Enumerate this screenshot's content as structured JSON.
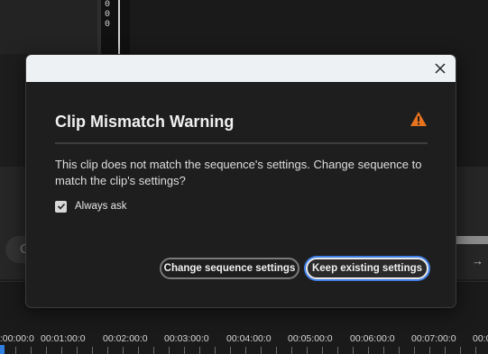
{
  "background": {
    "meter_values": [
      "0",
      "0",
      "0"
    ],
    "search_pill_text": "C",
    "timeline_labels": [
      "0:00:00:0",
      "00:01:00:0",
      "00:02:00:0",
      "00:03:00:0",
      "00:04:00:0",
      "00:05:00:0",
      "00:06:00:0",
      "00:07:00:0",
      "00:0"
    ]
  },
  "dialog": {
    "title": "Clip Mismatch Warning",
    "icon": "warning-icon",
    "message": "This clip does not match the sequence's settings. Change sequence to match the clip's settings?",
    "checkbox_label": "Always ask",
    "checkbox_checked": true,
    "secondary_button": "Change sequence settings",
    "primary_button": "Keep existing settings",
    "close_icon": "close-icon"
  },
  "colors": {
    "warning": "#e8731f",
    "focus_ring": "#3f7fe6",
    "playhead": "#2f7fe0"
  }
}
